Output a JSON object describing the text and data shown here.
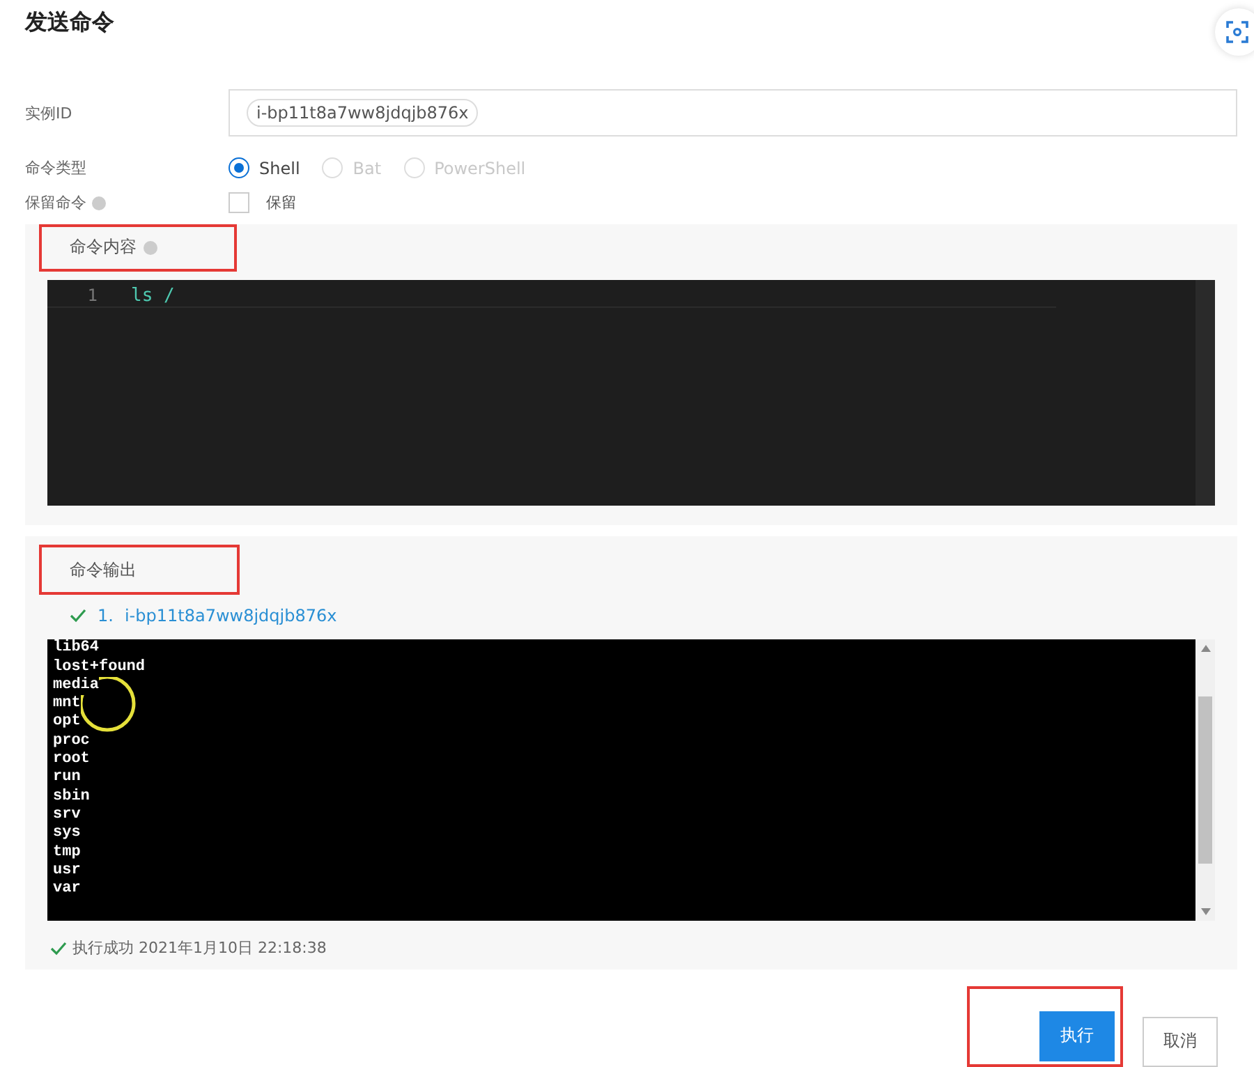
{
  "title": "发送命令",
  "instance_field": {
    "label": "实例ID",
    "tags": [
      "i-bp11t8a7ww8jdqjb876x"
    ]
  },
  "command_type": {
    "label": "命令类型",
    "options": [
      {
        "label": "Shell",
        "selected": true,
        "disabled": false
      },
      {
        "label": "Bat",
        "selected": false,
        "disabled": true
      },
      {
        "label": "PowerShell",
        "selected": false,
        "disabled": true
      }
    ]
  },
  "keep_command": {
    "label": "保留命令",
    "checkbox_label": "保留",
    "checked": false
  },
  "command_content": {
    "heading": "命令内容",
    "lines": [
      {
        "number": "1",
        "code": "ls /"
      }
    ]
  },
  "command_output": {
    "heading": "命令输出",
    "instance": {
      "index": "1.",
      "id": "i-bp11t8a7ww8jdqjb876x"
    },
    "output_lines": [
      "lib64",
      "lost+found",
      "media",
      "mnt",
      "opt",
      "proc",
      "root",
      "run",
      "sbin",
      "srv",
      "sys",
      "tmp",
      "usr",
      "var"
    ],
    "status": "执行成功 2021年1月10日 22:18:38"
  },
  "buttons": [
    {
      "label": "执行",
      "kind": "primary"
    },
    {
      "label": "取消",
      "kind": "secondary"
    }
  ]
}
